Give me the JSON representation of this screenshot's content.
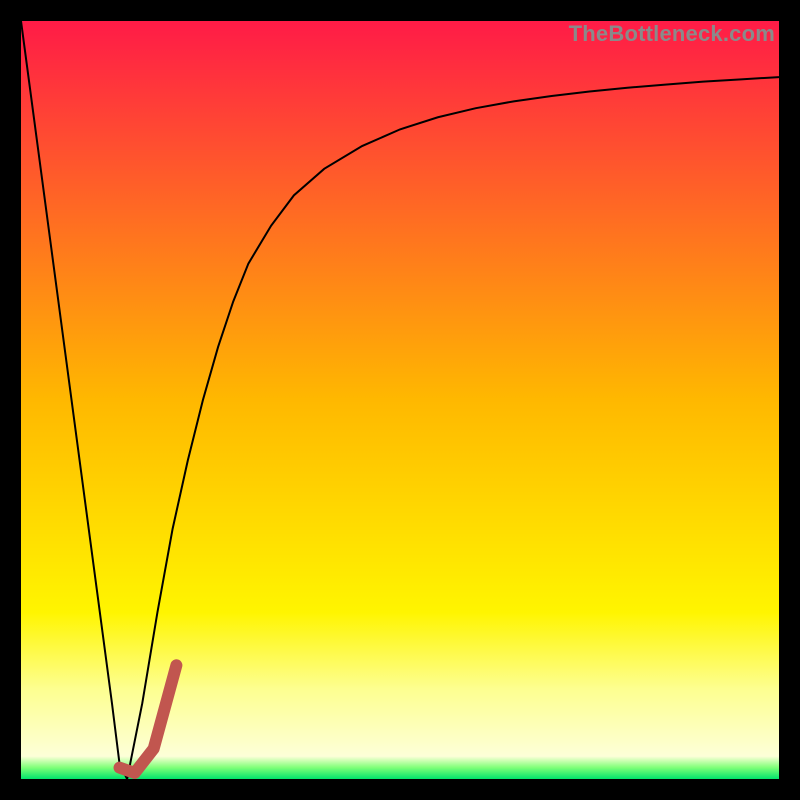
{
  "watermark": "TheBottleneck.com",
  "chart_data": {
    "type": "line",
    "title": "",
    "xlabel": "",
    "ylabel": "",
    "xlim": [
      0,
      100
    ],
    "ylim": [
      0,
      100
    ],
    "grid": false,
    "background_gradient": {
      "stops": [
        {
          "offset": 0.0,
          "color": "#ff1b47"
        },
        {
          "offset": 0.5,
          "color": "#ffb800"
        },
        {
          "offset": 0.78,
          "color": "#fff500"
        },
        {
          "offset": 0.88,
          "color": "#fdff8f"
        },
        {
          "offset": 0.97,
          "color": "#fdffd8"
        },
        {
          "offset": 0.985,
          "color": "#7eff78"
        },
        {
          "offset": 1.0,
          "color": "#00e36b"
        }
      ]
    },
    "series": [
      {
        "name": "bottleneck-curve",
        "color": "#000000",
        "width": 2,
        "x": [
          0.0,
          2.0,
          4.0,
          6.0,
          8.0,
          10.0,
          12.0,
          13.0,
          14.0,
          16.0,
          18.0,
          20.0,
          22.0,
          24.0,
          26.0,
          28.0,
          30.0,
          33.0,
          36.0,
          40.0,
          45.0,
          50.0,
          55.0,
          60.0,
          65.0,
          70.0,
          75.0,
          80.0,
          85.0,
          90.0,
          95.0,
          100.0
        ],
        "y": [
          100.0,
          85.0,
          70.0,
          55.0,
          40.0,
          25.0,
          10.0,
          2.0,
          0.0,
          10.0,
          22.0,
          33.0,
          42.0,
          50.0,
          57.0,
          63.0,
          68.0,
          73.0,
          77.0,
          80.5,
          83.5,
          85.7,
          87.3,
          88.5,
          89.4,
          90.1,
          90.7,
          91.2,
          91.6,
          92.0,
          92.3,
          92.6
        ]
      },
      {
        "name": "marker-hook",
        "color": "#c1564f",
        "width": 12,
        "linecap": "round",
        "x": [
          13.0,
          15.0,
          17.5,
          20.5
        ],
        "y": [
          1.5,
          0.8,
          4.0,
          15.0
        ]
      }
    ]
  }
}
